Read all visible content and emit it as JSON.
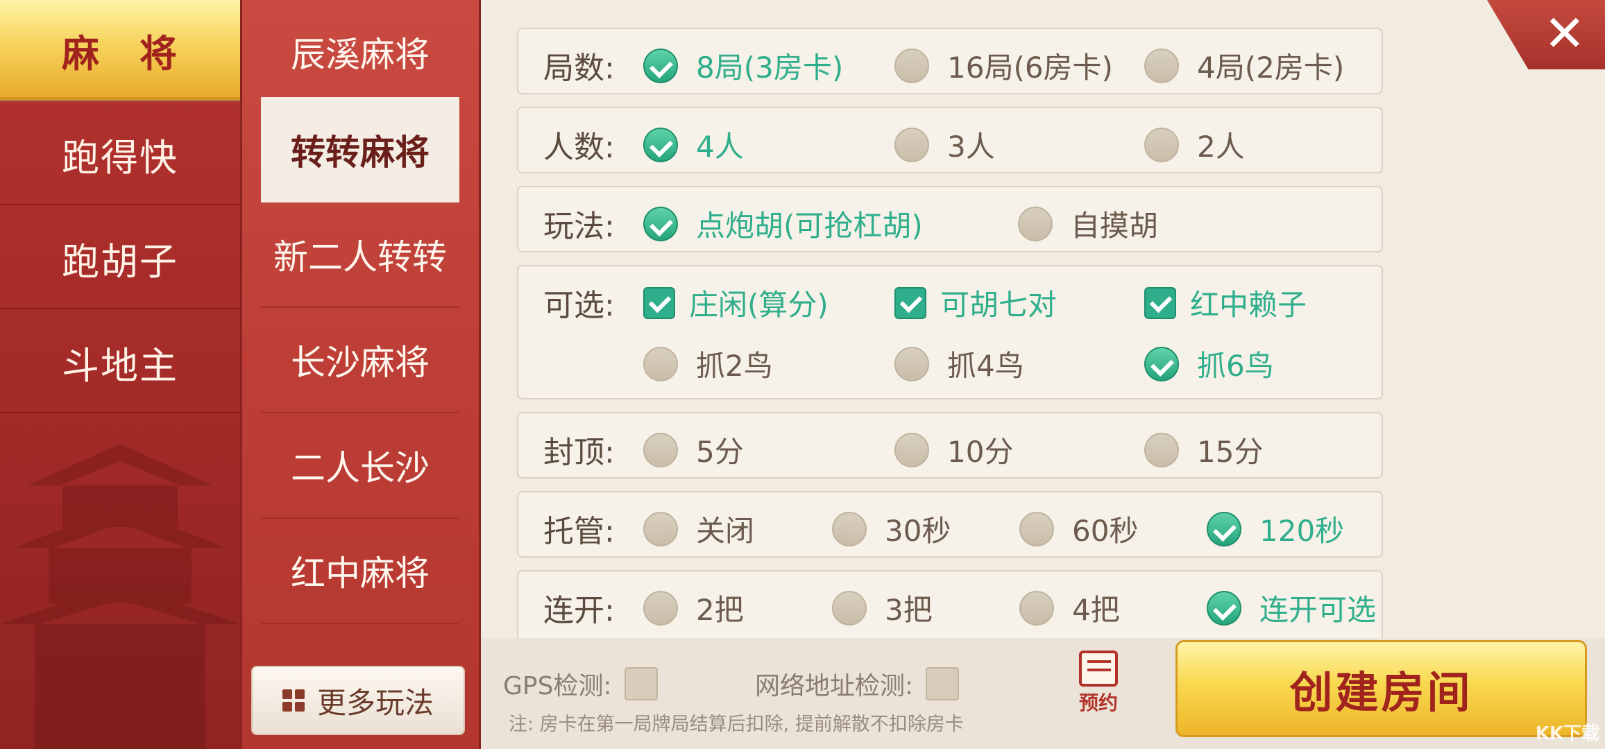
{
  "categories": [
    {
      "label": "麻　将",
      "active": true
    },
    {
      "label": "跑得快"
    },
    {
      "label": "跑胡子"
    },
    {
      "label": "斗地主"
    }
  ],
  "sub_items": [
    {
      "label": "辰溪麻将"
    },
    {
      "label": "转转麻将",
      "active": true
    },
    {
      "label": "新二人转转"
    },
    {
      "label": "长沙麻将"
    },
    {
      "label": "二人长沙"
    },
    {
      "label": "红中麻将"
    }
  ],
  "more_button": {
    "label": "更多玩法",
    "icon": "grid-icon"
  },
  "rows": {
    "rounds": {
      "label": "局数:",
      "options": [
        {
          "text": "8局(3房卡)",
          "selected": true
        },
        {
          "text": "16局(6房卡)",
          "selected": false
        },
        {
          "text": "4局(2房卡)",
          "selected": false
        }
      ]
    },
    "players": {
      "label": "人数:",
      "options": [
        {
          "text": "4人",
          "selected": true
        },
        {
          "text": "3人",
          "selected": false
        },
        {
          "text": "2人",
          "selected": false
        }
      ]
    },
    "play": {
      "label": "玩法:",
      "options": [
        {
          "text": "点炮胡(可抢杠胡)",
          "selected": true
        },
        {
          "text": "自摸胡",
          "selected": false
        }
      ]
    },
    "optional": {
      "label": "可选:",
      "checkboxes": [
        {
          "text": "庄闲(算分)",
          "checked": true
        },
        {
          "text": "可胡七对",
          "checked": true
        },
        {
          "text": "红中赖子",
          "checked": true
        }
      ],
      "options": [
        {
          "text": "抓2鸟",
          "selected": false
        },
        {
          "text": "抓4鸟",
          "selected": false
        },
        {
          "text": "抓6鸟",
          "selected": true
        }
      ]
    },
    "cap": {
      "label": "封顶:",
      "options": [
        {
          "text": "5分",
          "selected": false
        },
        {
          "text": "10分",
          "selected": false
        },
        {
          "text": "15分",
          "selected": false
        }
      ]
    },
    "auto": {
      "label": "托管:",
      "options": [
        {
          "text": "关闭",
          "selected": false
        },
        {
          "text": "30秒",
          "selected": false
        },
        {
          "text": "60秒",
          "selected": false
        },
        {
          "text": "120秒",
          "selected": true
        }
      ]
    },
    "continuous": {
      "label": "连开:",
      "options": [
        {
          "text": "2把",
          "selected": false
        },
        {
          "text": "3把",
          "selected": false
        },
        {
          "text": "4把",
          "selected": false
        },
        {
          "text": "连开可选",
          "selected": true
        }
      ]
    }
  },
  "gps_label": "GPS检测:",
  "net_label": "网络地址检测:",
  "note": "注: 房卡在第一局牌局结算后扣除, 提前解散不扣除房卡",
  "reserve_label": "预约",
  "create_button": "创建房间",
  "close_icon": "close-icon",
  "watermark": "KK下载",
  "colors": {
    "accent_green": "#2fae8c",
    "brand_red": "#b4332f",
    "button_gold": "#f8d84e"
  }
}
